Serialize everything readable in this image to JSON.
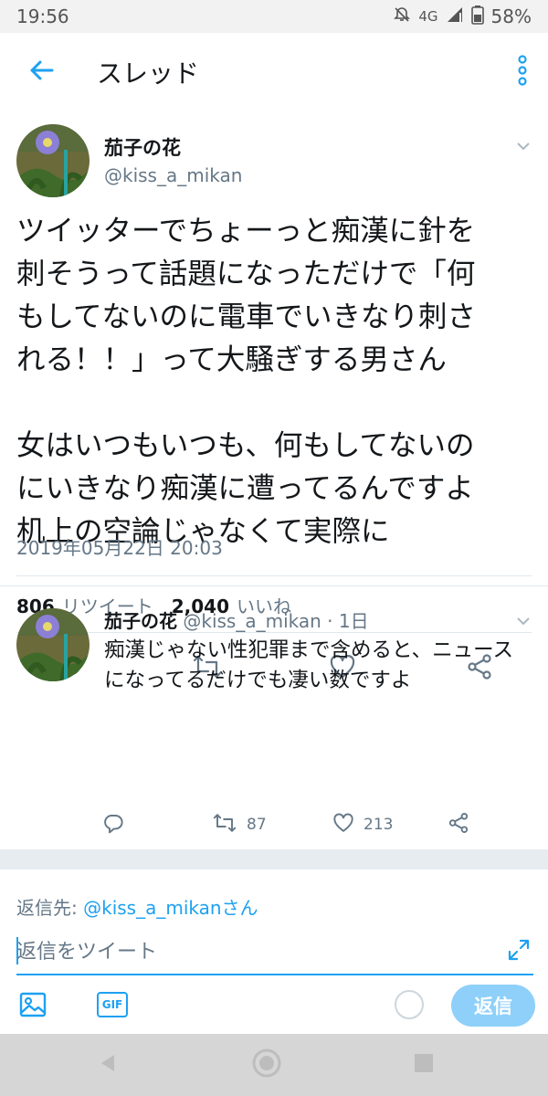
{
  "status_bar": {
    "time": "19:56",
    "network": "4G",
    "battery": "58%",
    "icons": [
      "mute-icon",
      "signal-icon",
      "battery-icon"
    ]
  },
  "header": {
    "title": "スレッド",
    "icons": [
      "back-arrow-icon",
      "more-options-icon"
    ]
  },
  "main_tweet": {
    "display_name": "茄子の花",
    "handle": "@kiss_a_mikan",
    "text_lines": [
      "ツイッターでちょーっと痴漢に針を",
      "刺そうって話題になっただけで「何",
      "もしてないのに電車でいきなり刺さ",
      "れる！！」って大騒ぎする男さん",
      "",
      "女はいつもいつも、何もしてないの",
      "にいきなり痴漢に遭ってるんですよ",
      "机上の空論じゃなくて実際に"
    ],
    "timestamp": "2019年05月22日 20:03",
    "retweet_count": "806",
    "retweet_label": "リツイート",
    "like_count": "2,040",
    "like_label": "いいね",
    "action_icons": [
      "reply-icon",
      "retweet-icon",
      "like-icon",
      "share-icon"
    ]
  },
  "reply_tweet": {
    "display_name": "茄子の花",
    "handle_time": "@kiss_a_mikan · 1日",
    "text_lines": [
      "痴漢じゃない性犯罪まで含めると、ニュース",
      "になってるだけでも凄い数ですよ"
    ],
    "retweet_count": "87",
    "like_count": "213"
  },
  "composer": {
    "reply_to_label": "返信先:",
    "reply_to_mention": "@kiss_a_mikanさん",
    "placeholder": "返信をツイート",
    "gif_label": "GIF",
    "reply_button": "返信"
  },
  "colors": {
    "accent": "#1da1f2",
    "reply_button_disabled": "#8ed0f9",
    "secondary_text": "#657786",
    "divider": "#e1e8ed"
  }
}
